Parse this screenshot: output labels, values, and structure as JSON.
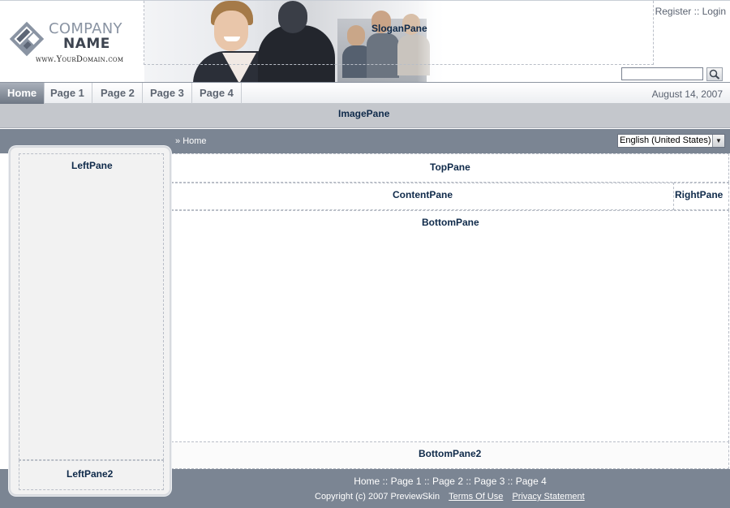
{
  "header": {
    "logo": {
      "line1": "COMPANY",
      "line2": "NAME",
      "domain": "www.YourDomain.com"
    },
    "slogan_pane": "SloganPane",
    "register": "Register",
    "separator": "::",
    "login": "Login",
    "search": {
      "value": "",
      "placeholder": ""
    }
  },
  "nav": {
    "items": [
      {
        "label": "Home",
        "active": true
      },
      {
        "label": "Page 1",
        "active": false
      },
      {
        "label": "Page 2",
        "active": false
      },
      {
        "label": "Page 3",
        "active": false
      },
      {
        "label": "Page 4",
        "active": false
      }
    ],
    "date": "August 14, 2007"
  },
  "image_pane": "ImagePane",
  "breadcrumb": {
    "marker": "»",
    "label": "Home"
  },
  "language": {
    "selected": "English (United States)"
  },
  "panes": {
    "left": "LeftPane",
    "left2": "LeftPane2",
    "top": "TopPane",
    "content": "ContentPane",
    "right": "RightPane",
    "bottom": "BottomPane",
    "bottom2": "BottomPane2"
  },
  "footer": {
    "links": [
      "Home",
      "Page 1",
      "Page 2",
      "Page 3",
      "Page 4"
    ],
    "link_separator": " :: ",
    "copyright": "Copyright (c) 2007 PreviewSkin",
    "terms": "Terms Of Use",
    "privacy": "Privacy Statement"
  },
  "colors": {
    "accent_navy": "#0f2a4a",
    "bar_gray": "#7b8593",
    "nav_active": "#6f7885"
  }
}
